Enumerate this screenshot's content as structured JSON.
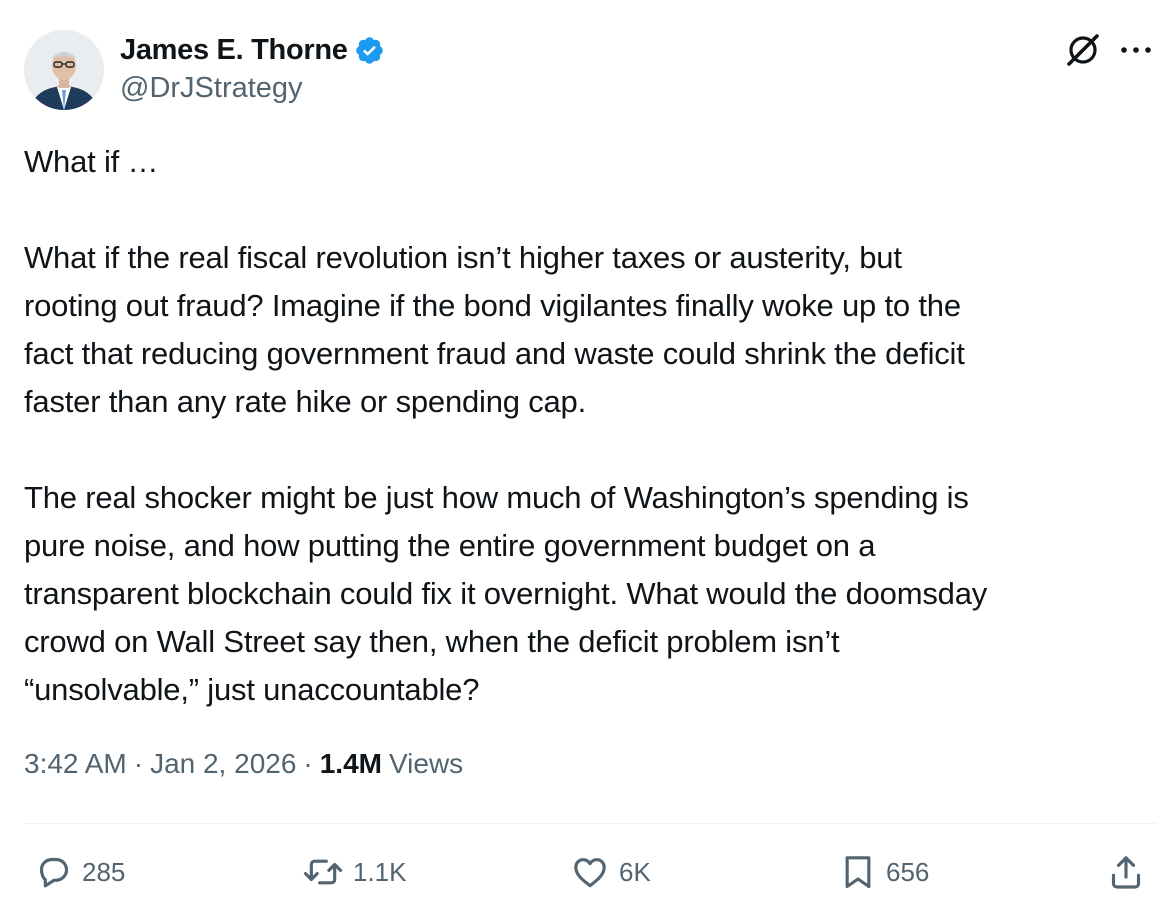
{
  "author": {
    "display_name": "James E. Thorne",
    "handle": "@DrJStrategy",
    "verified_color": "#1d9bf0"
  },
  "header_icons": {
    "grok": "grok-icon",
    "more": "more-icon"
  },
  "post": {
    "paragraphs": [
      [
        "What if …"
      ],
      [
        "What if the real fiscal revolution isn’t higher taxes or austerity, but",
        "rooting out fraud? Imagine if the bond vigilantes finally woke up to the",
        "fact that reducing government fraud and waste could shrink the deficit",
        "faster than any rate hike or spending cap."
      ],
      [
        "The real shocker might be just how much of Washington’s spending is",
        "pure noise, and how putting the entire government budget on a",
        "transparent blockchain could fix it overnight. What would the doomsday",
        "crowd on Wall Street say then, when the deficit problem isn’t",
        "“unsolvable,” just unaccountable?"
      ]
    ]
  },
  "meta": {
    "time": "3:42 AM",
    "separator": "·",
    "date": "Jan 2, 2026",
    "views_count": "1.4M",
    "views_label": "Views"
  },
  "actions": {
    "replies": "285",
    "reposts": "1.1K",
    "likes": "6K",
    "bookmarks": "656"
  },
  "colors": {
    "text": "#0f1419",
    "secondary": "#536471",
    "divider": "#eff3f4",
    "accent": "#1d9bf0"
  }
}
